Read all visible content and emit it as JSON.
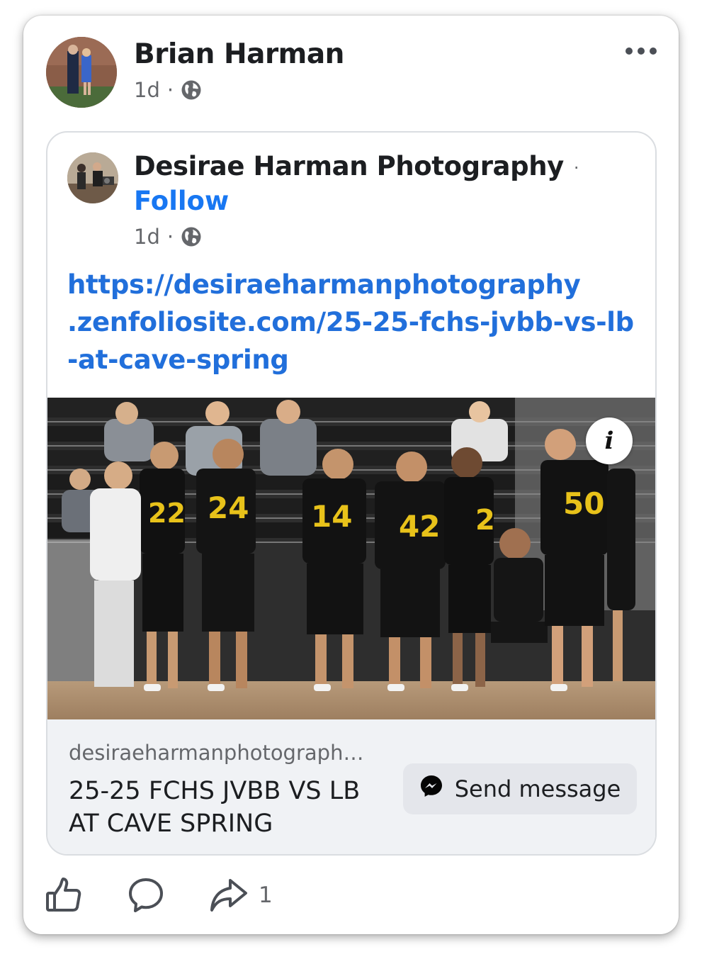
{
  "post": {
    "author": "Brian Harman",
    "time": "1d",
    "separator": "·",
    "audience_icon": "globe-icon"
  },
  "shared": {
    "page_name": "Desirae Harman Photography",
    "name_separator": "·",
    "follow_label": "Follow",
    "time": "1d",
    "separator": "·",
    "audience_icon": "globe-icon",
    "link_lines": [
      "https://desiraeharmanphotography",
      ".zenfoliosite.com/25-25-fchs-jvbb-vs-lb",
      "-at-cave-spring"
    ]
  },
  "photo": {
    "info_label": "i",
    "jersey_numbers": [
      "22",
      "24",
      "14",
      "42",
      "2",
      "50"
    ]
  },
  "preview": {
    "domain": "desiraeharmanphotograph…",
    "title_lines": [
      "25-25 FCHS JVBB VS LB",
      "AT CAVE SPRING"
    ],
    "send_label": "Send message"
  },
  "actions": {
    "like_icon": "thumbs-up-icon",
    "comment_icon": "comment-icon",
    "share_icon": "share-icon",
    "share_count": "1"
  },
  "colors": {
    "link": "#216fdb",
    "follow": "#1877f2",
    "muted": "#65676b",
    "text": "#1c1e21",
    "preview_bg": "#f0f2f5",
    "button_bg": "#e4e6eb"
  }
}
